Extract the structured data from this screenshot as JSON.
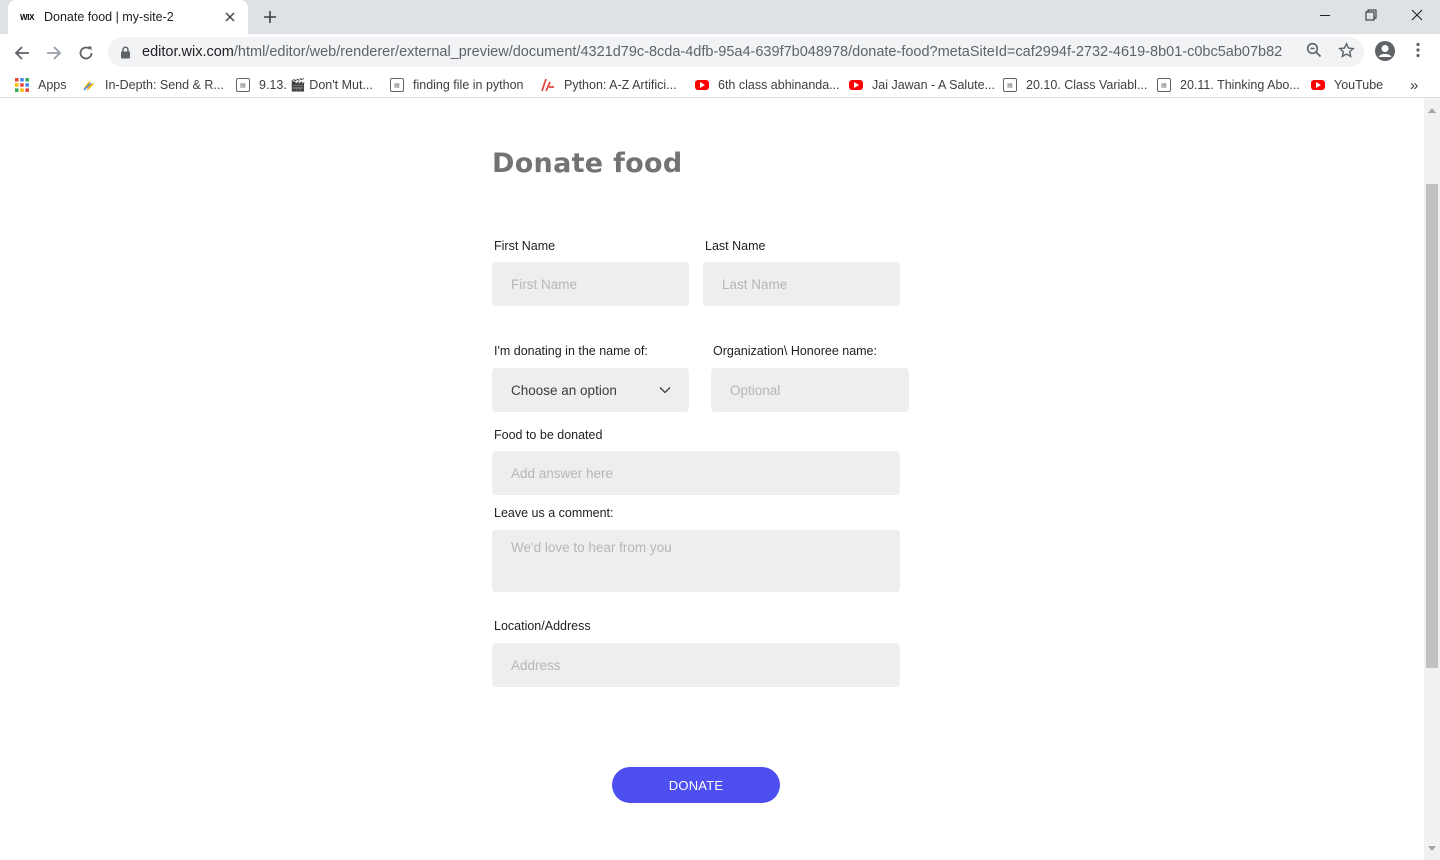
{
  "browser": {
    "tab": {
      "favicon": "WIX",
      "title": "Donate food | my-site-2"
    },
    "url": {
      "host": "editor.wix.com",
      "path": "/html/editor/web/renderer/external_preview/document/4321d79c-8cda-4dfb-95a4-639f7b048978/donate-food?metaSiteId=caf2994f-2732-4619-8b01-c0bc5ab07b82"
    },
    "bookmarks": [
      {
        "label": "Apps",
        "icon": "apps-grid-icon"
      },
      {
        "label": "In-Depth: Send & R...",
        "icon": "bolt-icon"
      },
      {
        "label": "9.13. 🎬 Don't Mut...",
        "icon": "document-icon"
      },
      {
        "label": "finding file in python",
        "icon": "document-icon"
      },
      {
        "label": "Python: A-Z Artifici...",
        "icon": "udemy-icon"
      },
      {
        "label": "6th class abhinanda...",
        "icon": "youtube-icon"
      },
      {
        "label": "Jai Jawan - A Salute...",
        "icon": "youtube-icon"
      },
      {
        "label": "20.10. Class Variabl...",
        "icon": "document-icon"
      },
      {
        "label": "20.11. Thinking Abo...",
        "icon": "document-icon"
      },
      {
        "label": "YouTube",
        "icon": "youtube-icon"
      }
    ],
    "more_bookmarks": "»"
  },
  "form": {
    "title": "Donate food",
    "first_name": {
      "label": "First Name",
      "placeholder": "First Name"
    },
    "last_name": {
      "label": "Last Name",
      "placeholder": "Last Name"
    },
    "donating_name": {
      "label": "I'm donating in the name of:",
      "value": "Choose an option"
    },
    "organization": {
      "label": "Organization\\ Honoree name:",
      "placeholder": "Optional"
    },
    "food": {
      "label": "Food to be donated",
      "placeholder": "Add answer here"
    },
    "comment": {
      "label": "Leave us a comment:",
      "placeholder": "We'd love to hear from you"
    },
    "location": {
      "label": "Location/Address",
      "placeholder": "Address"
    },
    "submit_label": "DONATE"
  },
  "colors": {
    "accent": "#4d4ff0",
    "field_bg": "#eeeeee",
    "title": "#737373"
  }
}
